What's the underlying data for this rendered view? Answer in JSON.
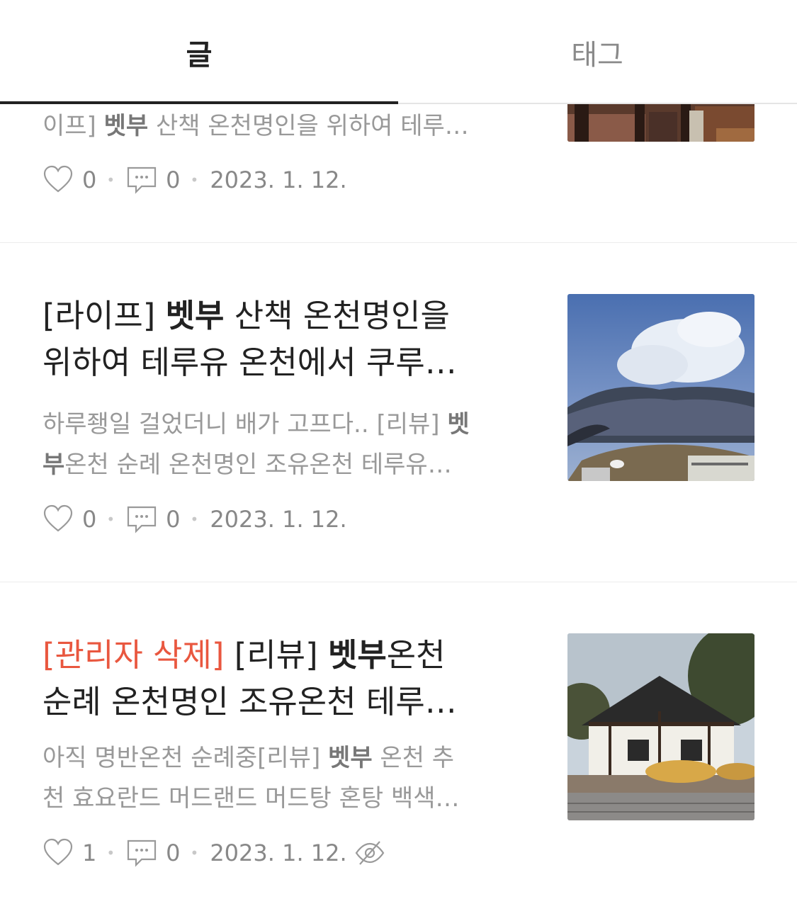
{
  "tabs": [
    {
      "label": "글",
      "active": true
    },
    {
      "label": "태그",
      "active": false
    }
  ],
  "posts": [
    {
      "excerpt_prefix": "이프] ",
      "excerpt_bold": "벳부",
      "excerpt_suffix": " 산책 온천명인을 위하여 테루…",
      "likes": "0",
      "comments": "0",
      "date": "2023. 1. 12."
    },
    {
      "title_prefix": "[라이프] ",
      "title_bold": "벳부",
      "title_line1_suffix": " 산책 온천명인을",
      "title_line2": "위하여 테루유 온천에서 쿠루…",
      "excerpt_line1_prefix": "하루좽일 걸었더니 배가 고프다.. [리뷰] ",
      "excerpt_line1_bold": "벳",
      "excerpt_line2_bold": "부",
      "excerpt_line2_suffix": "온천 순례 온천명인 조유온천 테루유…",
      "likes": "0",
      "comments": "0",
      "date": "2023. 1. 12."
    },
    {
      "title_deleted_tag": "[관리자 삭제]",
      "title_line1_middle": " [리뷰] ",
      "title_bold": "벳부",
      "title_line1_suffix": "온천",
      "title_line2": "순례 온천명인 조유온천 테루…",
      "excerpt_line1_prefix": "아직 명반온천 순례중[리뷰] ",
      "excerpt_line1_bold": "벳부",
      "excerpt_line1_suffix": " 온천 추",
      "excerpt_line2": "천 효요란드 머드랜드 머드탕 혼탕 백색…",
      "likes": "1",
      "comments": "0",
      "date": "2023. 1. 12."
    }
  ],
  "icons": {
    "like": "heart-icon",
    "comment": "comment-icon",
    "hidden": "eye-off-icon"
  },
  "colors": {
    "deleted_tag": "#e9573f",
    "active_tab": "#222222",
    "inactive_tab": "#8a8a8a"
  }
}
